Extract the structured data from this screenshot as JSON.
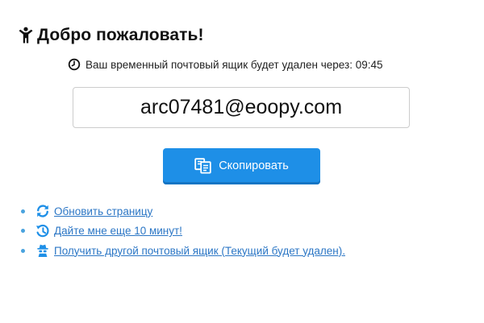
{
  "header": {
    "title": "Добро пожаловать!",
    "icon": "welcome-person-icon"
  },
  "timer": {
    "icon": "clock-icon",
    "label": "Ваш временный почтовый ящик будет удален через: 09:45"
  },
  "email": {
    "address": "arc07481@eoopy.com"
  },
  "copy_button": {
    "icon": "copy-icon",
    "label": "Скопировать",
    "color": "#1e8fe7"
  },
  "actions": [
    {
      "icon": "refresh-icon",
      "label": "Обновить страницу"
    },
    {
      "icon": "history-icon",
      "label": "Дайте мне еще 10 минут!"
    },
    {
      "icon": "spy-icon",
      "label": "Получить другой почтовый ящик (Текущий будет удален)."
    }
  ],
  "colors": {
    "link": "#2b76c5",
    "icon_blue": "#1e8fe7",
    "bullet": "#4aa3de"
  }
}
